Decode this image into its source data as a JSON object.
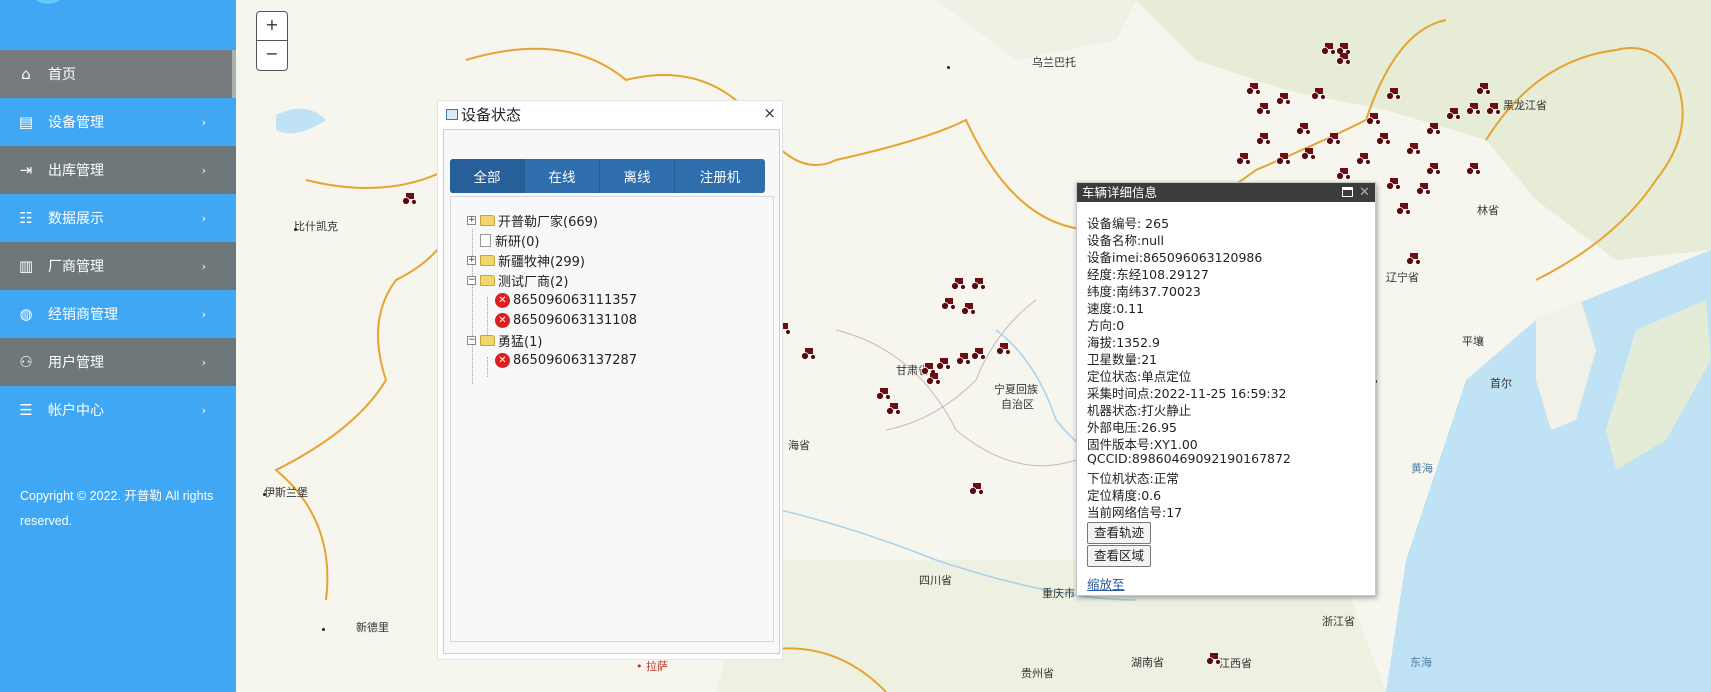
{
  "sidebar": {
    "items": [
      {
        "label": "首页",
        "icon": "home-icon"
      },
      {
        "label": "设备管理",
        "icon": "document-icon"
      },
      {
        "label": "出库管理",
        "icon": "export-icon"
      },
      {
        "label": "数据展示",
        "icon": "list-icon"
      },
      {
        "label": "厂商管理",
        "icon": "building-icon"
      },
      {
        "label": "经销商管理",
        "icon": "globe-icon"
      },
      {
        "label": "用户管理",
        "icon": "user-settings-icon"
      },
      {
        "label": "帐户中心",
        "icon": "user-list-icon"
      }
    ],
    "chevron": "›",
    "copyright": "Copyright © 2022. 开普勒 All rights reserved."
  },
  "map": {
    "zoom_in": "+",
    "zoom_out": "−",
    "places": {
      "wulanbatuo": "乌兰巴托",
      "bishikaike": "比什凯克",
      "yisilanbao": "伊斯兰堡",
      "xindeli": "新德里",
      "gansu": "甘肃省",
      "ningxia1": "宁夏回族",
      "ningxia2": "自治区",
      "qinghai": "海省",
      "sichuan": "四川省",
      "chongqing": "重庆市",
      "guizhou": "贵州省",
      "hunan": "湖南省",
      "jiangxi": "江西省",
      "zhejiang": "浙江省",
      "heilongjiang": "黑龙江省",
      "jilin": "林省",
      "liaoning": "辽宁省",
      "pingrang": "平壤",
      "shouer": "首尔",
      "huanghai": "黄海",
      "donghai": "东海",
      "lasa": "• 拉萨"
    }
  },
  "status_panel": {
    "title": "设备状态",
    "close": "×",
    "tabs": [
      "全部",
      "在线",
      "离线",
      "注册机"
    ],
    "tree": {
      "n1": "开普勒厂家(669)",
      "n2": "新研(0)",
      "n3": "新疆牧神(299)",
      "n4": "测试厂商(2)",
      "n4a": "865096063111357",
      "n4b": "865096063131108",
      "n5": "勇猛(1)",
      "n5a": "865096063137287"
    }
  },
  "detail": {
    "title": "车辆详细信息",
    "fields": [
      "设备编号: 265",
      "设备名称:null",
      "设备imei:865096063120986",
      "经度:东经108.29127",
      "纬度:南纬37.70023",
      "速度:0.11",
      "方向:0",
      "海拔:1352.9",
      "卫星数量:21",
      "定位状态:单点定位",
      "采集时间点:2022-11-25 16:59:32",
      "机器状态:打火静止",
      "外部电压:26.95",
      "固件版本号:XY1.00",
      "QCCID:89860469092190167872",
      "下位机状态:正常",
      "定位精度:0.6",
      "当前网络信号:17"
    ],
    "btn_track": "查看轨迹",
    "btn_area": "查看区域",
    "zoom_link": "缩放至"
  }
}
